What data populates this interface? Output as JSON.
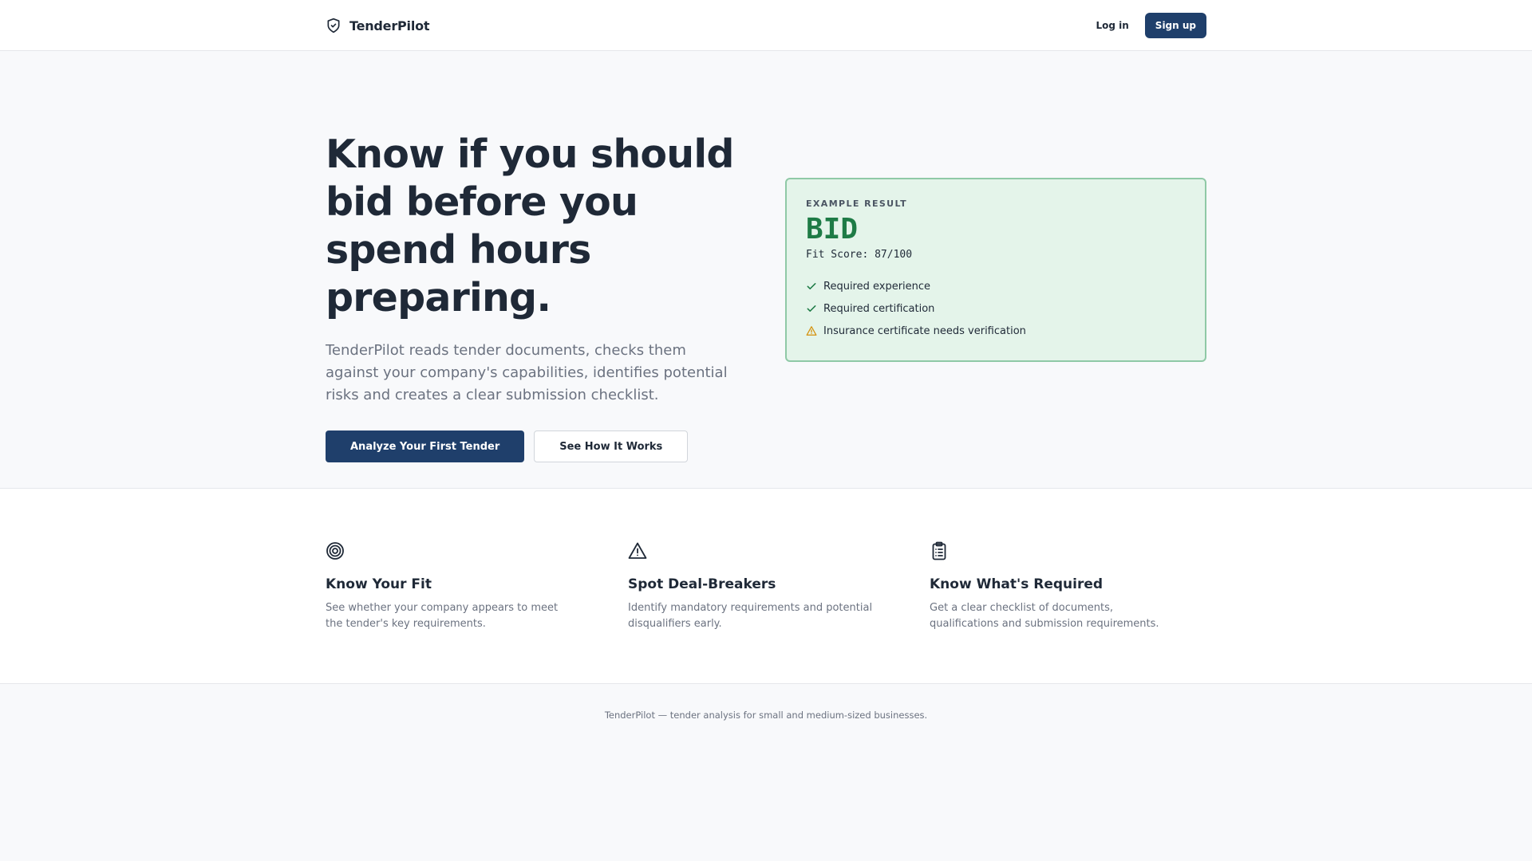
{
  "header": {
    "brand": "TenderPilot",
    "login_label": "Log in",
    "signup_label": "Sign up"
  },
  "hero": {
    "title": "Know if you should bid before you spend hours preparing.",
    "description": "TenderPilot reads tender documents, checks them against your company's capabilities, identifies potential risks and creates a clear submission checklist.",
    "primary_cta": "Analyze Your First Tender",
    "secondary_cta": "See How It Works"
  },
  "example_result": {
    "label": "EXAMPLE RESULT",
    "verdict": "BID",
    "score_text": "Fit Score: 87/100",
    "checks": [
      {
        "status": "pass",
        "icon": "check-icon",
        "text": "Required experience"
      },
      {
        "status": "pass",
        "icon": "check-icon",
        "text": "Required certification"
      },
      {
        "status": "warning",
        "icon": "warning-icon",
        "text": "Insurance certificate needs verification"
      }
    ]
  },
  "features": [
    {
      "icon": "target-icon",
      "title": "Know Your Fit",
      "description": "See whether your company appears to meet the tender's key requirements."
    },
    {
      "icon": "alert-triangle-icon",
      "title": "Spot Deal-Breakers",
      "description": "Identify mandatory requirements and potential disqualifiers early."
    },
    {
      "icon": "clipboard-list-icon",
      "title": "Know What's Required",
      "description": "Get a clear checklist of documents, qualifications and submission requirements."
    }
  ],
  "footer": {
    "text": "TenderPilot — tender analysis for small and medium-sized businesses."
  },
  "colors": {
    "primary": "#1f3f6b",
    "success": "#1e7b46",
    "success_bg": "#e4f4ea",
    "warning": "#d4900a"
  }
}
